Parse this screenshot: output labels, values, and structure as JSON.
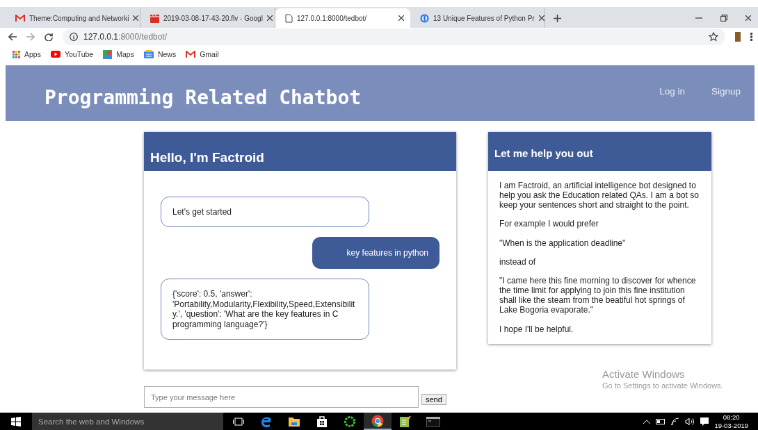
{
  "browser": {
    "tabs": [
      {
        "title": "Theme:Computing and Networki",
        "selected": false,
        "kind": "mail"
      },
      {
        "title": "2019-03-08-17-43-20.flv - Googl",
        "selected": false,
        "kind": "video"
      },
      {
        "title": "127.0.0.1:8000/tedbot/",
        "selected": true,
        "kind": "page"
      },
      {
        "title": "13 Unique Features of Python Pr",
        "selected": false,
        "kind": "site"
      }
    ],
    "address": {
      "host": "127.0.0.1",
      "path": ":8000/tedbot/"
    },
    "bookmarks": [
      {
        "label": "Apps",
        "kind": "apps"
      },
      {
        "label": "YouTube",
        "kind": "youtube"
      },
      {
        "label": "Maps",
        "kind": "maps"
      },
      {
        "label": "News",
        "kind": "news"
      },
      {
        "label": "Gmail",
        "kind": "mail"
      }
    ]
  },
  "site": {
    "title": "Programming Related Chatbot",
    "nav": [
      "Log in",
      "Signup"
    ]
  },
  "chat": {
    "title": "Hello, I'm Factroid",
    "messages": [
      {
        "kind": "bot",
        "text": "Let's get started"
      },
      {
        "kind": "user",
        "text": "key features in python"
      },
      {
        "kind": "bot",
        "text": "{'score': 0.5, 'answer': 'Portability,Modularity,Flexibility,Speed,Extensibility.', 'question': 'What are the key features in C programming language?'}"
      }
    ],
    "input": {
      "placeholder": "Type your message here"
    },
    "send": "send"
  },
  "help": {
    "title": "Let me help you out",
    "paragraphs": [
      "I am Factroid, an artificial intelligence bot designed to help you ask the Education related QAs. I am a bot so keep your sentences short and straight to the point.",
      "For example I would prefer",
      "\"When is the application deadline\"",
      "instead of",
      "\"I came here this fine morning to discover for whence the time limit for applying to join this fine institution shall like the steam from the beatiful hot springs of Lake Bogoria evaporate.\"",
      "I hope I'll be helpful."
    ]
  },
  "watermark": {
    "title": "Activate Windows",
    "subtitle": "Go to Settings to activate Windows."
  },
  "taskbar": {
    "search_placeholder": "Search the web and Windows",
    "apps": [
      {
        "kind": "task-view",
        "active": false
      },
      {
        "kind": "edge",
        "active": false
      },
      {
        "kind": "folder",
        "active": false
      },
      {
        "kind": "store",
        "active": false
      },
      {
        "kind": "ring",
        "active": false
      },
      {
        "kind": "chrome",
        "active": true
      },
      {
        "kind": "notepad",
        "active": false
      },
      {
        "kind": "terminal",
        "active": false
      }
    ],
    "time": "08:20",
    "date": "19-03-2019"
  }
}
